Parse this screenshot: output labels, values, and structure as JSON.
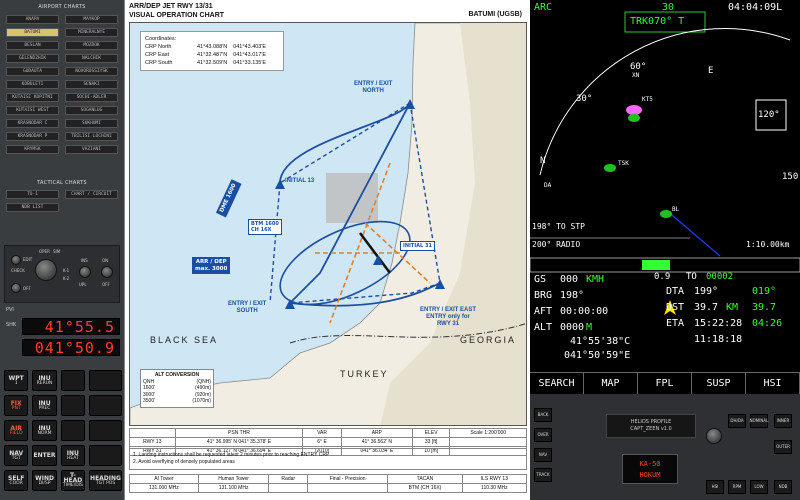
{
  "left_panel": {
    "airport_title": "AIRPORT CHARTS",
    "airports": [
      "ANAPA",
      "MAYKOP",
      "BATUMI",
      "MINERALNYE",
      "BESLAN",
      "MOZDOK",
      "GELENDZHIK",
      "NALCHIK",
      "GUDAUTA",
      "NOVOROSSIYSK",
      "KOBULETI",
      "SENAKI",
      "KUTAISI KOPITNI",
      "SOCHI-ADLER",
      "KUTAISI WEST",
      "SOGANLUG",
      "KRASNODAR C",
      "SUKHUMI",
      "KRASNODAR P",
      "TBILISI LOCHINI",
      "KRYMSK",
      "VAZIANI"
    ],
    "selected_airport": "BATUMI",
    "tactical_title": "TACTICAL CHARTS",
    "tactical": [
      "TO-1",
      "CHART / CIRCUIT",
      "NDB LIST"
    ],
    "switches": [
      "OPER",
      "SIM",
      "EDIT",
      "CHECK",
      "OFF",
      "K-1",
      "K-2",
      "ON",
      "INS",
      "UPL",
      "OFF"
    ],
    "pvi_label": "PVI",
    "shk_label": "SHK",
    "readout1": "41°55.5",
    "readout2": "041°50.9",
    "keys": [
      {
        "t": "WPT",
        "s": "1"
      },
      {
        "t": "INU",
        "s": "RERUN"
      },
      {
        "t": "",
        "s": ""
      },
      {
        "t": "",
        "s": ""
      },
      {
        "t": "FIX",
        "s": "PNT"
      },
      {
        "t": "INU",
        "s": "PREC"
      },
      {
        "t": "",
        "s": ""
      },
      {
        "t": "",
        "s": ""
      },
      {
        "t": "AIR",
        "s": "FIELD"
      },
      {
        "t": "INU",
        "s": "NORM"
      },
      {
        "t": "",
        "s": ""
      },
      {
        "t": "",
        "s": ""
      },
      {
        "t": "NAV",
        "s": "TGT"
      },
      {
        "t": "ENTER",
        "s": ""
      },
      {
        "t": "INU",
        "s": "HEAT"
      },
      {
        "t": "",
        "s": ""
      },
      {
        "t": "SELF",
        "s": "COOR"
      },
      {
        "t": "WIND",
        "s": "DI/SP"
      },
      {
        "t": "T-HEAD",
        "s": "TIME/DIS"
      },
      {
        "t": "HEADING",
        "s": "TGT POS"
      }
    ]
  },
  "chart": {
    "title_line1": "ARR/DEP  JET  RWY  13/31",
    "title_line2": "VISUAL  OPERATION  CHART",
    "airport": "BATUMI (UGSB)",
    "coords": {
      "title": "Coordinates:",
      "rows": [
        {
          "name": "CRP North",
          "lat": "41°43.088'N",
          "lon": "041°43.403'E"
        },
        {
          "name": "CRP East",
          "lat": "41°32.487'N",
          "lon": "041°43.017'E"
        },
        {
          "name": "CRP South",
          "lat": "41°32.509'N",
          "lon": "041°33.135'E"
        }
      ]
    },
    "labels": {
      "entry_north": "ENTRY / EXIT\nNORTH",
      "entry_east": "ENTRY / EXIT EAST\nENTRY only for\nRWY 31",
      "entry_south": "ENTRY / EXIT\nSOUTH",
      "initial13": "INITIAL 13",
      "initial31": "INITIAL 31",
      "btm": "BTM 1600\nCH 16X",
      "arrdep": "ARR / DEP\nmax. 3000",
      "black_sea": "BLACK  SEA",
      "georgia": "GEORGIA",
      "turkey": "TURKEY",
      "dme": "DME 1600"
    },
    "alt_conv": {
      "title": "ALT CONVERSION",
      "head": [
        "QNH",
        "(QNH)"
      ],
      "rows": [
        [
          "1600'",
          "(490m)"
        ],
        [
          "3000'",
          "(920m)"
        ],
        [
          "3500'",
          "(1070m)"
        ]
      ]
    },
    "table1": {
      "head": [
        "",
        "PSN THR",
        "VAR",
        "ARP",
        "ELEV",
        "Scale 1:200'000"
      ],
      "rows": [
        [
          "RWY 13",
          "41° 36.995' N   041° 35.378' E",
          "6° E",
          "41° 36.562' N",
          "33 [ft]",
          ""
        ],
        [
          "RWY 31",
          "41° 36.127' N   041° 36.694' E",
          "(2010)",
          "041° 36.034' E",
          "10 [m]",
          ""
        ]
      ]
    },
    "notes": [
      "1. Landing instructions shall be requested latest 2 minutes prior to reaching ENTRY CRP",
      "2. Avoid overflying of densely populated areas"
    ],
    "table2": {
      "head": [
        "AI Tower",
        "Human Tower",
        "Radar",
        "Final - Precision",
        "TACAN",
        "ILS RWY 13"
      ],
      "row": [
        "131.000 MHz",
        "131.100 MHz",
        "",
        "",
        "BTM (CH 16X)",
        "110.30 MHz"
      ]
    }
  },
  "mfd": {
    "mode": "ARC",
    "range": "30",
    "clock": "04:04:09L",
    "trk": "TRK070° T",
    "heading_marks": [
      "60°",
      "E",
      "30°",
      "120°",
      "N",
      "150"
    ],
    "waypoints": [
      "XN",
      "KT5",
      "TSK",
      "DA",
      "BL"
    ],
    "to_stp": "198° TO STP",
    "radio": "200° RADIO",
    "scale": "1:10.00km",
    "xtk": "0.9",
    "to_label": "TO",
    "to_wpt": "00002",
    "gs_label": "GS",
    "gs": "000",
    "gs_unit": "KMH",
    "brg_label": "BRG",
    "brg": "198°",
    "aft_label": "AFT",
    "aft": "00:00:00",
    "alt_label": "ALT",
    "alt": "0000",
    "alt_unit": "M",
    "dta_label": "DTA",
    "dta": "199°",
    "dta2": "019°",
    "dst_label": "DST",
    "dst": "39.7",
    "dst_unit": "KM",
    "dst2": "39.7",
    "eta_label": "ETA",
    "eta": "15:22:28",
    "eta2": "04:26",
    "eta3": "11:18:18",
    "lat": "41°55'38\"C",
    "lon": "041°50'59\"E",
    "softkeys": [
      "SEARCH",
      "MAP",
      "FPL",
      "SUSP",
      "HSI"
    ]
  },
  "bottom": {
    "helios": "HELIOS PROFILE\nCAPT_ZEEN v1.0",
    "ka50": "KA-50\nHOKUM",
    "btns": [
      "BACK",
      "OVER",
      "NAV",
      "TRACK",
      "DH/DA",
      "NOMINAL",
      "INNER",
      "OUTER",
      "LOW",
      "RPM",
      "NDB",
      "HSI"
    ]
  },
  "colors": {
    "accent": "#1a4fa0",
    "danger": "#e03a2c",
    "mfd_green": "#33ff33",
    "mfd_cyan": "#3fe0ff",
    "magenta": "#ff66ff"
  }
}
